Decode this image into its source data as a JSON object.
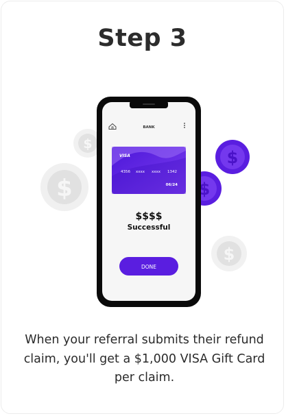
{
  "step": {
    "title": "Step 3"
  },
  "phone": {
    "header_title": "BANK",
    "home_icon": "home-icon",
    "menu_icon": "more-vertical-icon",
    "card": {
      "brand": "VISA",
      "number_groups": [
        "4356",
        "xxxx",
        "xxxx",
        "1342"
      ],
      "expiry": "06/24"
    },
    "amount": "$$$$",
    "status": "Successful",
    "done_label": "DONE"
  },
  "coins": {
    "symbol": "$"
  },
  "description": "When your referral submits their refund claim, you'll get a $1,000 VISA Gift Card per claim.",
  "colors": {
    "accent": "#5a1ee0",
    "card_gradient_start": "#4b16d8",
    "card_gradient_end": "#8a55f0",
    "phone_frame": "#0a0a0a",
    "title_text": "#2c2c2c",
    "grey_coin": "#e4e4e4"
  }
}
